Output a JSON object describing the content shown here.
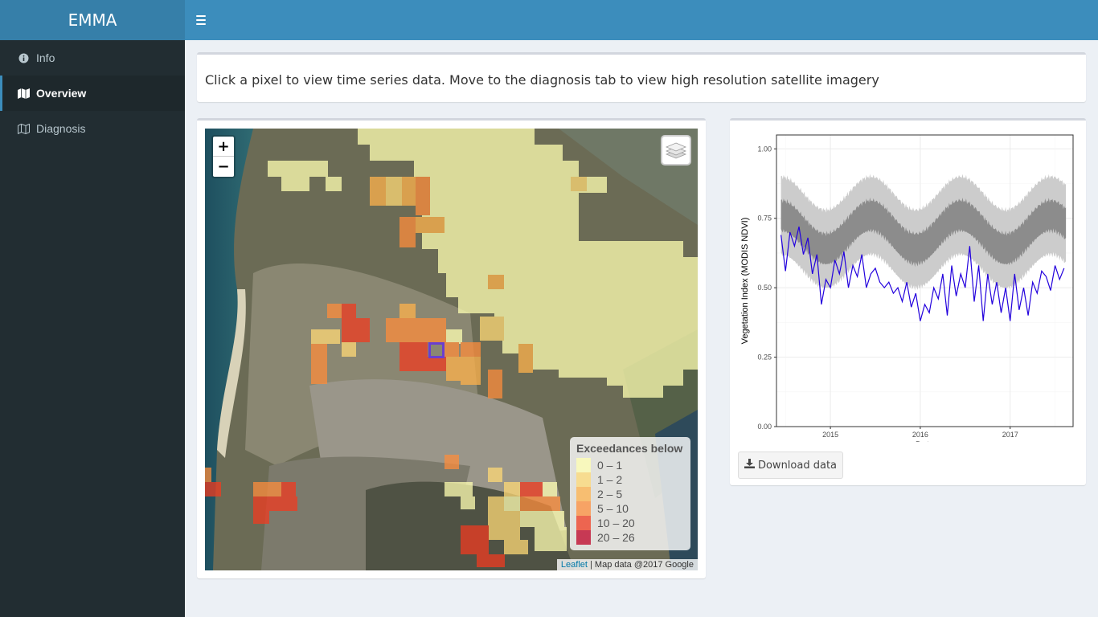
{
  "app": {
    "title": "EMMA"
  },
  "sidebar": {
    "items": [
      {
        "label": "Info",
        "icon": "info-circle-icon",
        "active": false
      },
      {
        "label": "Overview",
        "icon": "map-icon",
        "active": true
      },
      {
        "label": "Diagnosis",
        "icon": "map-outline-icon",
        "active": false
      }
    ]
  },
  "info": {
    "text": "Click a pixel to view time series data. Move to the diagnosis tab to view high resolution satellite imagery"
  },
  "map": {
    "zoom_in": "+",
    "zoom_out": "−",
    "legend": {
      "title": "Exceedances below",
      "items": [
        {
          "label": "0 – 1",
          "color": "#ffffb2"
        },
        {
          "label": "1 – 2",
          "color": "#fed976"
        },
        {
          "label": "2 – 5",
          "color": "#feb24c"
        },
        {
          "label": "5 – 10",
          "color": "#fd8d3c"
        },
        {
          "label": "10 – 20",
          "color": "#f03b20"
        },
        {
          "label": "20 – 26",
          "color": "#bd0026"
        }
      ]
    },
    "attribution": {
      "link": "Leaflet",
      "text": " | Map data @2017 Google"
    }
  },
  "chart": {
    "download_label": "Download data"
  },
  "chart_data": {
    "type": "line",
    "xlabel": "Date",
    "ylabel": "Vegetation Index (MODIS NDVI)",
    "ylim": [
      0,
      1.05
    ],
    "yticks": [
      "0.00",
      "0.25",
      "0.50",
      "0.75",
      "1.00"
    ],
    "xticks": [
      "2015",
      "2016",
      "2017"
    ],
    "xlim": [
      2014.4,
      2017.7
    ],
    "grid": true,
    "bands": [
      {
        "name": "outer",
        "color": "#cccccc",
        "center_mean": 0.7,
        "amplitude": 0.06,
        "halfwidth": 0.14
      },
      {
        "name": "inner",
        "color": "#8c8c8c",
        "center_mean": 0.7,
        "amplitude": 0.06,
        "halfwidth": 0.055
      }
    ],
    "series": [
      {
        "color": "#2200dd",
        "x": [
          2014.45,
          2014.5,
          2014.55,
          2014.6,
          2014.65,
          2014.7,
          2014.75,
          2014.8,
          2014.85,
          2014.9,
          2014.95,
          2015.0,
          2015.05,
          2015.1,
          2015.15,
          2015.2,
          2015.25,
          2015.3,
          2015.35,
          2015.4,
          2015.45,
          2015.5,
          2015.55,
          2015.6,
          2015.65,
          2015.7,
          2015.75,
          2015.8,
          2015.85,
          2015.9,
          2015.95,
          2016.0,
          2016.05,
          2016.1,
          2016.15,
          2016.2,
          2016.25,
          2016.3,
          2016.35,
          2016.4,
          2016.45,
          2016.5,
          2016.55,
          2016.6,
          2016.65,
          2016.7,
          2016.75,
          2016.8,
          2016.85,
          2016.9,
          2016.95,
          2017.0,
          2017.05,
          2017.1,
          2017.15,
          2017.2,
          2017.25,
          2017.3,
          2017.35,
          2017.4,
          2017.45,
          2017.5,
          2017.55,
          2017.6
        ],
        "values": [
          0.69,
          0.56,
          0.7,
          0.65,
          0.72,
          0.62,
          0.68,
          0.55,
          0.62,
          0.44,
          0.53,
          0.5,
          0.6,
          0.55,
          0.63,
          0.5,
          0.58,
          0.54,
          0.62,
          0.5,
          0.55,
          0.57,
          0.52,
          0.5,
          0.52,
          0.48,
          0.5,
          0.45,
          0.52,
          0.43,
          0.48,
          0.38,
          0.44,
          0.41,
          0.5,
          0.46,
          0.55,
          0.4,
          0.58,
          0.47,
          0.55,
          0.5,
          0.65,
          0.45,
          0.58,
          0.38,
          0.55,
          0.44,
          0.52,
          0.41,
          0.5,
          0.38,
          0.55,
          0.42,
          0.5,
          0.4,
          0.52,
          0.48,
          0.56,
          0.54,
          0.49,
          0.58,
          0.53,
          0.57
        ]
      }
    ]
  }
}
